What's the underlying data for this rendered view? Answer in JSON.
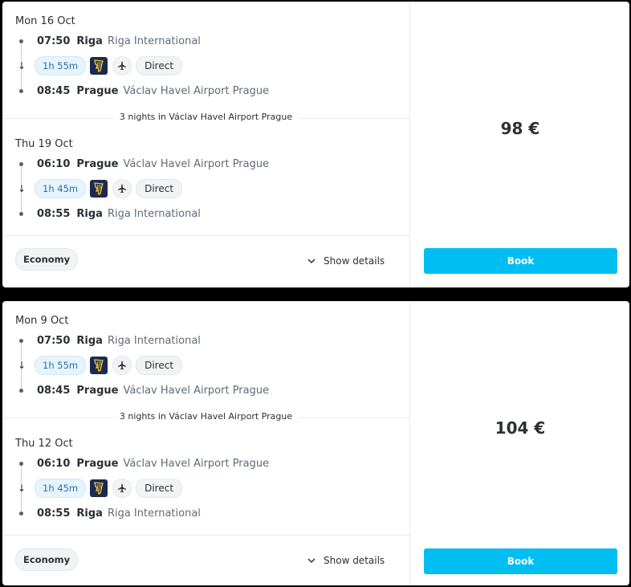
{
  "results": [
    {
      "outbound": {
        "date": "Mon 16 Oct",
        "dep_time": "07:50",
        "dep_city": "Riga",
        "dep_airport": "Riga International",
        "duration": "1h 55m",
        "stops": "Direct",
        "arr_time": "08:45",
        "arr_city": "Prague",
        "arr_airport": "Václav Havel Airport Prague"
      },
      "nights": "3 nights in Václav Havel Airport Prague",
      "inbound": {
        "date": "Thu 19 Oct",
        "dep_time": "06:10",
        "dep_city": "Prague",
        "dep_airport": "Václav Havel Airport Prague",
        "duration": "1h 45m",
        "stops": "Direct",
        "arr_time": "08:55",
        "arr_city": "Riga",
        "arr_airport": "Riga International"
      },
      "fare_class": "Economy",
      "details_label": "Show details",
      "price": "98 €",
      "book_label": "Book"
    },
    {
      "outbound": {
        "date": "Mon 9 Oct",
        "dep_time": "07:50",
        "dep_city": "Riga",
        "dep_airport": "Riga International",
        "duration": "1h 55m",
        "stops": "Direct",
        "arr_time": "08:45",
        "arr_city": "Prague",
        "arr_airport": "Václav Havel Airport Prague"
      },
      "nights": "3 nights in Václav Havel Airport Prague",
      "inbound": {
        "date": "Thu 12 Oct",
        "dep_time": "06:10",
        "dep_city": "Prague",
        "dep_airport": "Václav Havel Airport Prague",
        "duration": "1h 45m",
        "stops": "Direct",
        "arr_time": "08:55",
        "arr_city": "Riga",
        "arr_airport": "Riga International"
      },
      "fare_class": "Economy",
      "details_label": "Show details",
      "price": "104 €",
      "book_label": "Book"
    }
  ],
  "icons": {
    "airline": "ryanair-harp-logo-icon",
    "plane": "airplane-icon",
    "arrow": "arrow-down-icon",
    "chevron": "chevron-down-icon"
  },
  "colors": {
    "accent": "#00bdf2",
    "airline_bg": "#1b2a52",
    "duration_bg": "#e6f4fd"
  }
}
